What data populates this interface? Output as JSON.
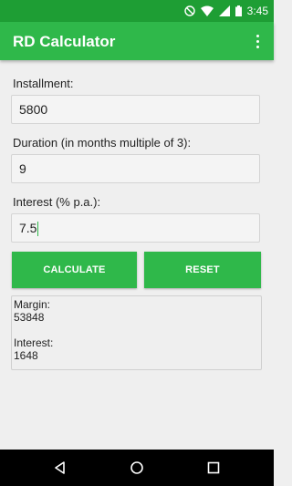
{
  "status_bar": {
    "time": "3:45",
    "icons": [
      "do-not-disturb-icon",
      "wifi-icon",
      "signal-icon",
      "battery-icon"
    ]
  },
  "app_bar": {
    "title": "RD Calculator",
    "menu_icon": "more-vert-icon"
  },
  "form": {
    "installment_label": "Installment:",
    "installment_value": "5800",
    "duration_label": "Duration (in months multiple of 3):",
    "duration_value": "9",
    "interest_label": "Interest (% p.a.):",
    "interest_value": "7.5"
  },
  "buttons": {
    "calculate_label": "CALCULATE",
    "reset_label": "RESET"
  },
  "result": {
    "margin_label": "Margin:",
    "margin_value": "53848",
    "interest_label": "Interest:",
    "interest_value": "1648"
  },
  "nav_bar": {
    "icons": [
      "back-icon",
      "home-icon",
      "recents-icon"
    ]
  },
  "colors": {
    "status_bar": "#1e9e34",
    "app_bar": "#2fb84a",
    "button": "#2fb84a",
    "background": "#efefef"
  }
}
